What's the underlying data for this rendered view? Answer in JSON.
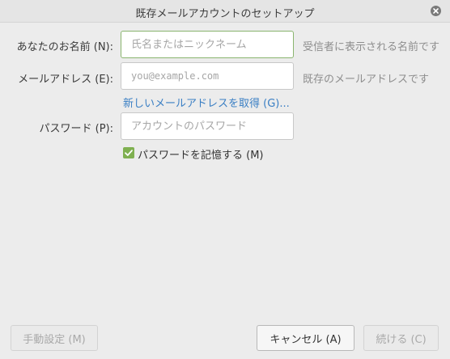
{
  "window": {
    "title": "既存メールアカウントのセットアップ",
    "close_icon": "close-icon"
  },
  "form": {
    "name": {
      "label": "あなたのお名前 (N):",
      "placeholder": "氏名またはニックネーム",
      "value": "",
      "hint": "受信者に表示される名前です"
    },
    "email": {
      "label": "メールアドレス (E):",
      "placeholder": "you@example.com",
      "value": "",
      "hint": "既存のメールアドレスです"
    },
    "new_address_link": "新しいメールアドレスを取得 (G)...",
    "password": {
      "label": "パスワード (P):",
      "placeholder": "アカウントのパスワード",
      "value": ""
    },
    "remember_password": {
      "label": "パスワードを記憶する (M)",
      "checked": true
    }
  },
  "buttons": {
    "manual": "手動設定 (M)",
    "cancel": "キャンセル (A)",
    "continue": "続ける (C)"
  },
  "colors": {
    "accent_green": "#7fb050",
    "link_blue": "#3a7fc4",
    "focus_border": "#8ab56f"
  }
}
